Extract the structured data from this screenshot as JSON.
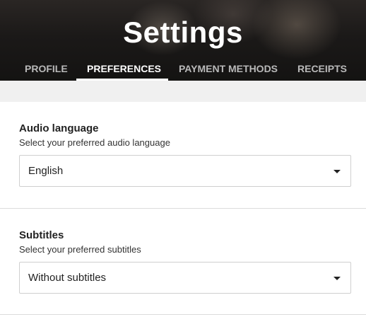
{
  "header": {
    "title": "Settings",
    "tabs": [
      {
        "label": "PROFILE"
      },
      {
        "label": "PREFERENCES",
        "active": true
      },
      {
        "label": "PAYMENT METHODS"
      },
      {
        "label": "RECEIPTS"
      }
    ]
  },
  "audio": {
    "title": "Audio language",
    "description": "Select your preferred audio language",
    "selected": "English"
  },
  "subtitles": {
    "title": "Subtitles",
    "description": "Select your preferred subtitles",
    "selected": "Without subtitles"
  },
  "icons": {
    "dropdown": "caret-down-icon"
  }
}
